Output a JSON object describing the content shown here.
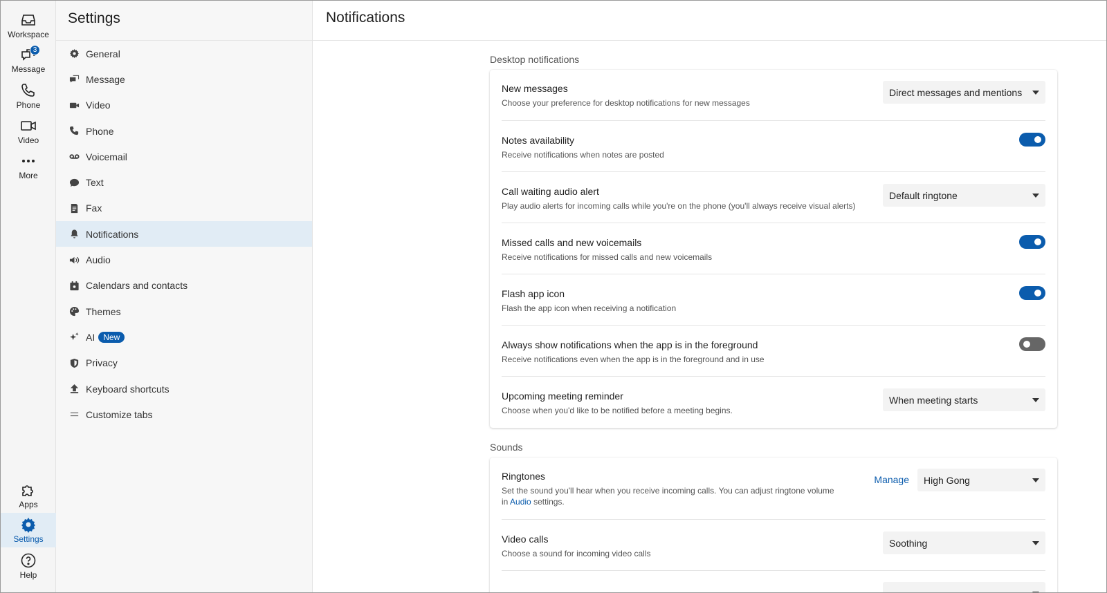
{
  "rail": {
    "workspace": "Workspace",
    "message": "Message",
    "message_badge": "3",
    "phone": "Phone",
    "video": "Video",
    "more": "More",
    "apps": "Apps",
    "settings": "Settings",
    "help": "Help"
  },
  "sidebar": {
    "title": "Settings",
    "items": [
      {
        "label": "General",
        "icon": "gear-icon"
      },
      {
        "label": "Message",
        "icon": "chat-icon"
      },
      {
        "label": "Video",
        "icon": "video-icon"
      },
      {
        "label": "Phone",
        "icon": "phone-icon"
      },
      {
        "label": "Voicemail",
        "icon": "voicemail-icon"
      },
      {
        "label": "Text",
        "icon": "text-bubble-icon"
      },
      {
        "label": "Fax",
        "icon": "fax-icon"
      },
      {
        "label": "Notifications",
        "icon": "bell-icon"
      },
      {
        "label": "Audio",
        "icon": "speaker-icon"
      },
      {
        "label": "Calendars and contacts",
        "icon": "calendar-icon"
      },
      {
        "label": "Themes",
        "icon": "palette-icon"
      },
      {
        "label": "AI",
        "icon": "sparkle-icon",
        "badge": "New"
      },
      {
        "label": "Privacy",
        "icon": "shield-icon"
      },
      {
        "label": "Keyboard shortcuts",
        "icon": "upload-arrow-icon"
      },
      {
        "label": "Customize tabs",
        "icon": "equals-icon"
      }
    ],
    "active": "Notifications"
  },
  "main": {
    "title": "Notifications",
    "desktop": {
      "section_title": "Desktop notifications",
      "new_messages": {
        "title": "New messages",
        "desc": "Choose your preference for desktop notifications for new messages",
        "value": "Direct messages and mentions"
      },
      "notes": {
        "title": "Notes availability",
        "desc": "Receive notifications when notes are posted",
        "on": true
      },
      "call_waiting": {
        "title": "Call waiting audio alert",
        "desc": "Play audio alerts for incoming calls while you're on the phone (you'll always receive visual alerts)",
        "value": "Default ringtone"
      },
      "missed": {
        "title": "Missed calls and new voicemails",
        "desc": "Receive notifications for missed calls and new voicemails",
        "on": true
      },
      "flash": {
        "title": "Flash app icon",
        "desc": "Flash the app icon when receiving a notification",
        "on": true
      },
      "foreground": {
        "title": "Always show notifications when the app is in the foreground",
        "desc": "Receive notifications even when the app is in the foreground and in use",
        "on": false
      },
      "meeting": {
        "title": "Upcoming meeting reminder",
        "desc": "Choose when you'd like to be notified before a meeting begins.",
        "value": "When meeting starts"
      }
    },
    "sounds": {
      "section_title": "Sounds",
      "ringtones": {
        "title": "Ringtones",
        "desc_a": "Set the sound you'll hear when you receive incoming calls. You can adjust ringtone volume in",
        "desc_link": "Audio",
        "desc_b": "settings.",
        "manage": "Manage",
        "value": "High Gong"
      },
      "video_calls": {
        "title": "Video calls",
        "desc": "Choose a sound for incoming video calls",
        "value": "Soothing"
      }
    }
  },
  "colors": {
    "accent": "#0b5cad",
    "active_bg": "#e1ecf5",
    "toggle_off": "#666666"
  }
}
